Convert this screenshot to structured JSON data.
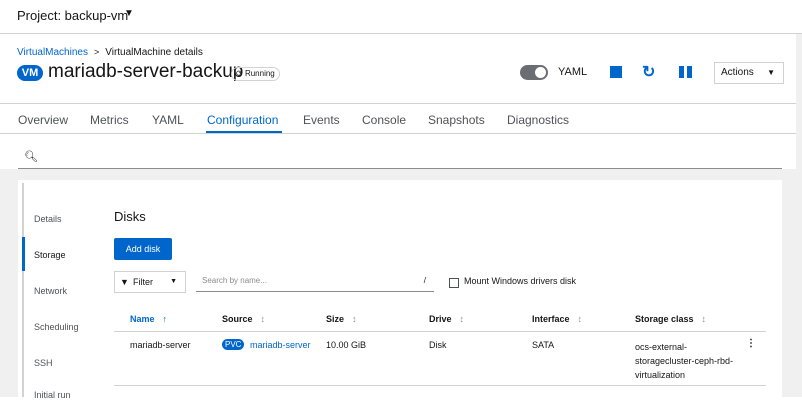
{
  "project": {
    "label": "Project: backup-vm"
  },
  "breadcrumb": {
    "parent": "VirtualMachines",
    "current": "VirtualMachine details"
  },
  "vm": {
    "badge": "VM",
    "name": "mariadb-server-backup",
    "status": "Running"
  },
  "toolbar": {
    "yaml_label": "YAML",
    "yaml_toggle_on": false,
    "actions_label": "Actions"
  },
  "tabs": [
    "Overview",
    "Metrics",
    "YAML",
    "Configuration",
    "Events",
    "Console",
    "Snapshots",
    "Diagnostics"
  ],
  "active_tab": "Configuration",
  "search": {
    "placeholder": ""
  },
  "config_nav": [
    "Details",
    "Storage",
    "Network",
    "Scheduling",
    "SSH",
    "Initial run"
  ],
  "active_config_nav": "Storage",
  "disks": {
    "title": "Disks",
    "add_button": "Add disk",
    "filter_label": "Filter",
    "name_search_placeholder": "Search by name...",
    "search_shortcut": "/",
    "mount_windows_label": "Mount Windows drivers disk",
    "mount_windows_checked": false,
    "columns": [
      "Name",
      "Source",
      "Size",
      "Drive",
      "Interface",
      "Storage class"
    ],
    "sorted_column": "Name",
    "rows": [
      {
        "name": "mariadb-server",
        "source_badge": "PVC",
        "source": "mariadb-server",
        "size": "10.00 GiB",
        "drive": "Disk",
        "interface": "SATA",
        "storage_class": "ocs-external-storagecluster-ceph-rbd-virtualization"
      }
    ]
  },
  "colors": {
    "accent": "#0066cc",
    "border": "#d2d2d2",
    "bg_gray": "#f0f0f0"
  }
}
